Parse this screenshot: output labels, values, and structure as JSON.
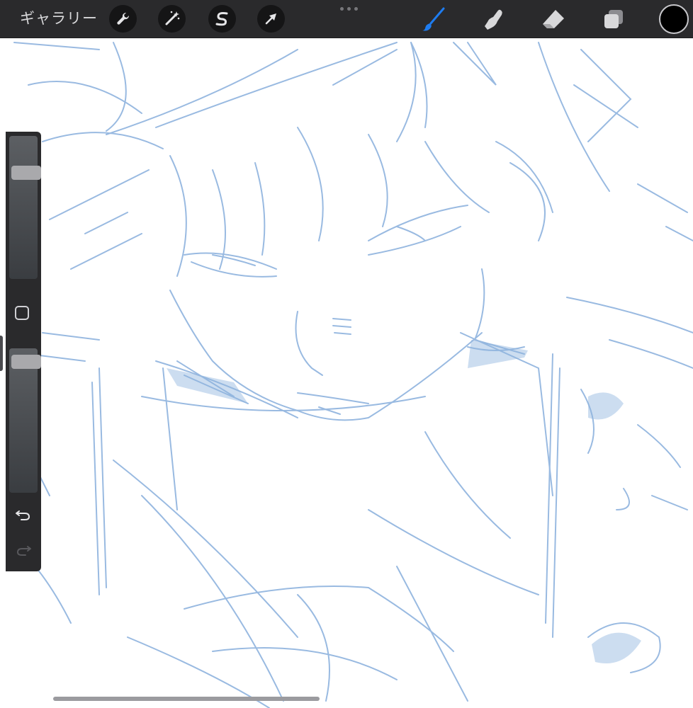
{
  "toolbar": {
    "gallery_label": "ギャラリー",
    "left_tools": [
      {
        "name": "actions",
        "icon": "wrench-icon"
      },
      {
        "name": "adjustments",
        "icon": "magic-wand-icon"
      },
      {
        "name": "selection",
        "icon": "selection-s-icon"
      },
      {
        "name": "transform",
        "icon": "arrow-cursor-icon"
      }
    ],
    "right_tools": [
      {
        "name": "brush",
        "icon": "brush-icon",
        "active": true
      },
      {
        "name": "smudge",
        "icon": "smudge-finger-icon",
        "active": false
      },
      {
        "name": "eraser",
        "icon": "eraser-icon",
        "active": false
      },
      {
        "name": "layers",
        "icon": "layers-icon",
        "active": false
      }
    ],
    "current_color": "#000000",
    "active_color": "#1e7cf0"
  },
  "sidebar": {
    "brush_size_level": 0.77,
    "brush_opacity_level": 0.95,
    "modify_button_icon": "square-icon",
    "undo_icon": "undo-icon",
    "redo_icon": "redo-icon"
  },
  "canvas": {
    "sketch_color": "#8fb3de",
    "background": "#ffffff"
  }
}
